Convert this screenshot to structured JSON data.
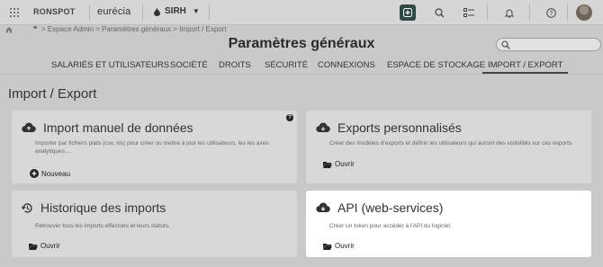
{
  "topbar": {
    "brand_primary": "RONSPOT",
    "brand_secondary": "eurécia",
    "app_switch_label": "SIRH",
    "icons": [
      "apps-grid-icon",
      "add-icon",
      "search-icon",
      "tasks-icon",
      "bell-icon",
      "help-icon",
      "avatar"
    ]
  },
  "breadcrumb": {
    "text": "> Espace Admin > Paramètres généraux > Import / Export"
  },
  "header": {
    "title": "Paramètres généraux",
    "search_placeholder": ""
  },
  "tabs": [
    {
      "label": "SALARIÉS ET UTILISATEURS",
      "active": false
    },
    {
      "label": "SOCIÉTÉ",
      "active": false
    },
    {
      "label": "DROITS",
      "active": false
    },
    {
      "label": "SÉCURITÉ",
      "active": false
    },
    {
      "label": "CONNEXIONS",
      "active": false
    },
    {
      "label": "ESPACE DE STOCKAGE",
      "active": false
    },
    {
      "label": "IMPORT / EXPORT",
      "active": true
    }
  ],
  "section_title": "Import / Export",
  "cards": {
    "import": {
      "title": "Import manuel de données",
      "description": "Importer par fichiers plats (csv, xls) pour créer ou mettre à jour les utilisateurs, les les axes analytiques…",
      "action": "Nouveau",
      "help": "?"
    },
    "exports": {
      "title": "Exports personnalisés",
      "description": "Créer des modèles d'exports et définir les utilisateurs qui auront des visibilités sur ces exports",
      "action": "Ouvrir"
    },
    "history": {
      "title": "Historique des imports",
      "description": "Retrouver tous les imports effectués et leurs statuts.",
      "action": "Ouvrir"
    },
    "api": {
      "title": "API (web-services)",
      "description": "Créer un token pour accéder à l'API du logiciel.",
      "action": "Ouvrir"
    }
  },
  "colors": {
    "overlay_bg": "#c9c9c9",
    "card_bg": "#d8d8d8",
    "highlight_card_bg": "#ffffff",
    "active_icon_bg": "#2f4a45"
  }
}
